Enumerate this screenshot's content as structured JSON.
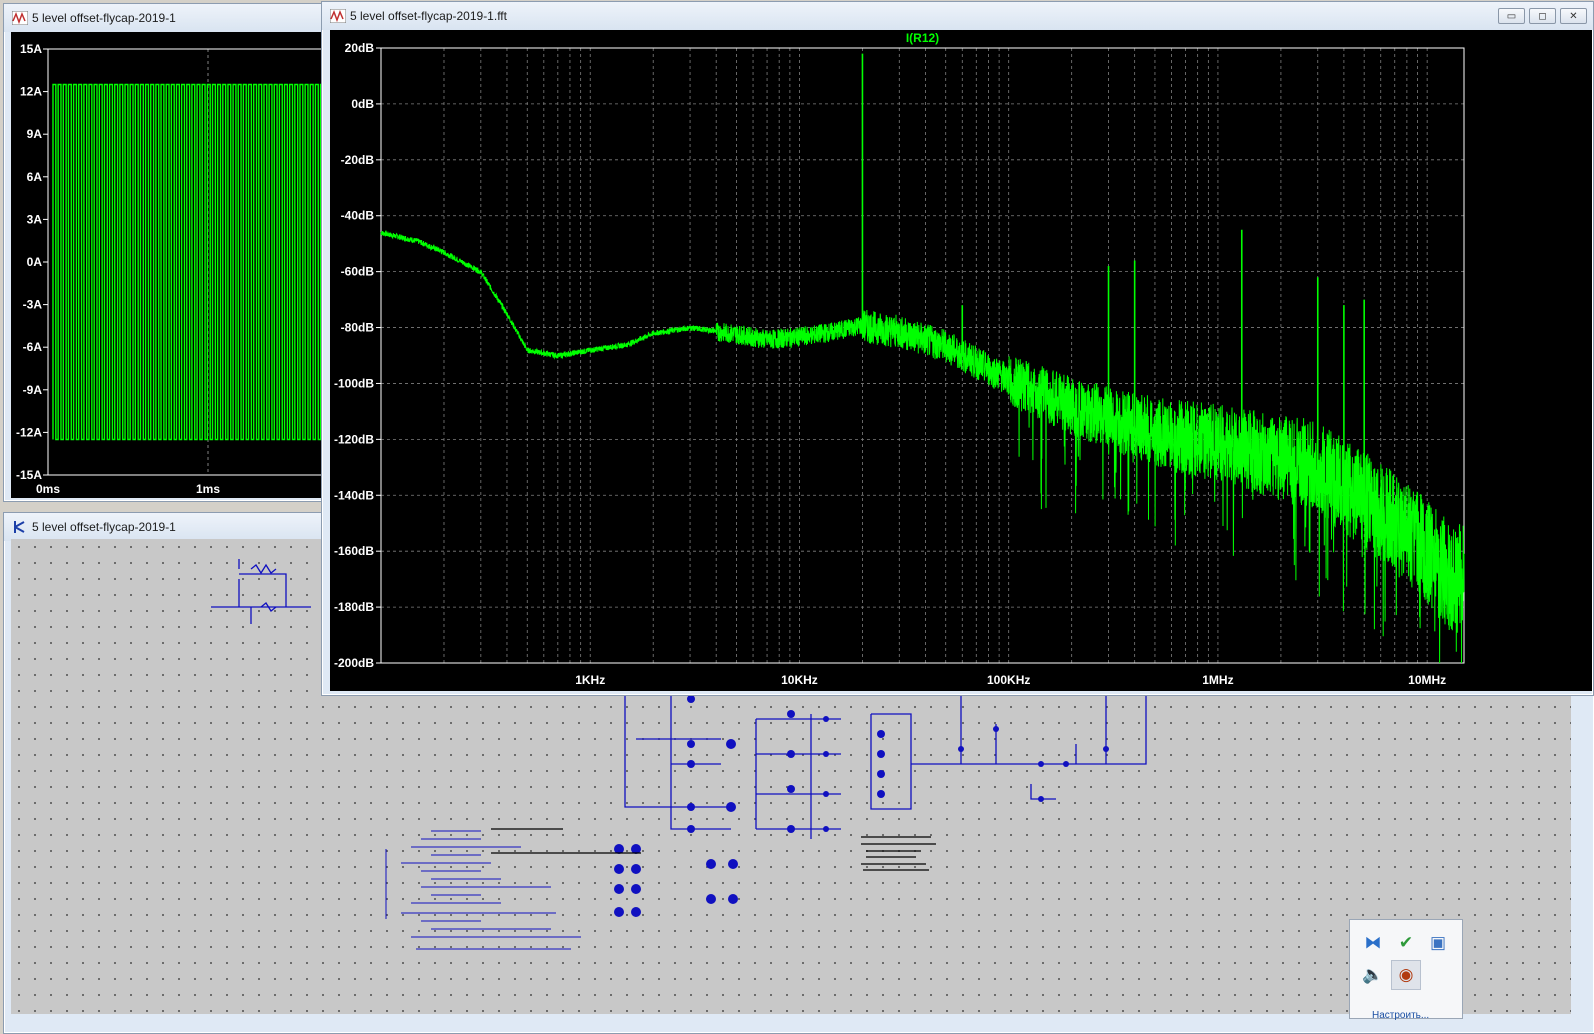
{
  "windows": {
    "time_plot": {
      "title": "5 level offset-flycap-2019-1",
      "y_ticks": [
        "15A",
        "12A",
        "9A",
        "6A",
        "3A",
        "0A",
        "-3A",
        "-6A",
        "-9A",
        "-12A",
        "-15A"
      ],
      "x_ticks": [
        "0ms",
        "1ms"
      ]
    },
    "schematic": {
      "title": "5 level offset-flycap-2019-1"
    },
    "fft_plot": {
      "title": "5 level offset-flycap-2019-1.fft",
      "buttons": {
        "minimize": "▭",
        "maximize": "◻",
        "close": "✕"
      },
      "trace_label": "I(R12)"
    }
  },
  "chart_data": [
    {
      "type": "line",
      "title": "I(R12)",
      "xlabel": "",
      "ylabel": "",
      "x_scale": "log",
      "x_range_hz": [
        100,
        15000000
      ],
      "ylim_db": [
        -200,
        20
      ],
      "y_ticks": [
        "20dB",
        "0dB",
        "-20dB",
        "-40dB",
        "-60dB",
        "-80dB",
        "-100dB",
        "-120dB",
        "-140dB",
        "-160dB",
        "-180dB",
        "-200dB"
      ],
      "x_ticks": [
        "1KHz",
        "10KHz",
        "100KHz",
        "1MHz",
        "10MHz"
      ],
      "grid": true,
      "trace_color": "#00ff00",
      "series": [
        {
          "x": [
            100,
            150,
            200,
            300,
            400,
            500,
            700,
            1000,
            1500,
            2000,
            3000,
            5000,
            7000,
            10000,
            15000,
            19000,
            20000,
            21000,
            30000,
            50000,
            70000,
            100000,
            150000,
            200000,
            300000,
            400000,
            500000,
            700000,
            1000000,
            1500000,
            2000000,
            3000000,
            4000000,
            5000000,
            7000000,
            10000000,
            13000000
          ],
          "y": [
            -46,
            -49,
            -53,
            -60,
            -75,
            -88,
            -90,
            -88,
            -86,
            -82,
            -80,
            -82,
            -84,
            -83,
            -81,
            -79,
            18,
            -79,
            -81,
            -86,
            -92,
            -98,
            -103,
            -107,
            -111,
            -114,
            -116,
            -118,
            -120,
            -123,
            -125,
            -128,
            -135,
            -140,
            -148,
            -158,
            -168
          ]
        }
      ],
      "peaks_hz_db": [
        [
          20000,
          18
        ],
        [
          60000,
          -72
        ],
        [
          300000,
          -58
        ],
        [
          400000,
          -56
        ],
        [
          1300000,
          -45
        ],
        [
          3000000,
          -62
        ],
        [
          4000000,
          -72
        ],
        [
          5000000,
          -70
        ]
      ]
    },
    {
      "type": "line",
      "title": "",
      "xlabel": "",
      "ylabel": "",
      "ylim": [
        -15,
        15
      ],
      "y_ticks": [
        "15A",
        "12A",
        "9A",
        "6A",
        "3A",
        "0A",
        "-3A",
        "-6A",
        "-9A",
        "-12A",
        "-15A"
      ],
      "x_ticks": [
        "0ms",
        "1ms"
      ],
      "grid": true,
      "trace_color": "#00ff00",
      "series": [
        {
          "amplitude": 12.5,
          "cycles_visible": 55
        }
      ]
    }
  ],
  "tray": {
    "icons": [
      "network-icon",
      "safely-remove-icon",
      "display-icon",
      "volume-icon",
      "eye-icon"
    ],
    "link": "Настроить..."
  }
}
